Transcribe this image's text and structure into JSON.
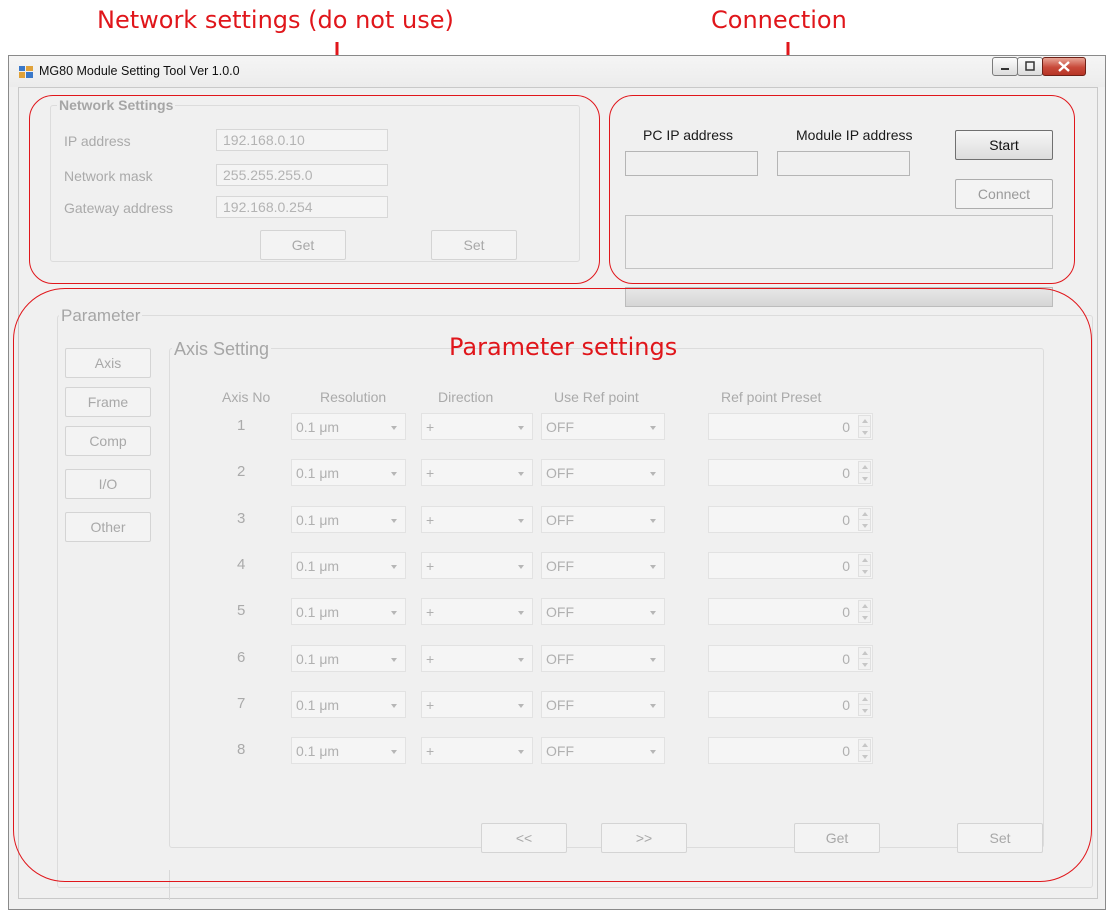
{
  "annotations": {
    "network_callout": "Network settings (do not use)",
    "connection_callout": "Connection",
    "parameter_callout": "Parameter settings",
    "color": "#e0161b"
  },
  "window": {
    "title": "MG80 Module Setting Tool Ver 1.0.0",
    "icon": "app-grid-icon"
  },
  "network": {
    "group_label": "Network Settings",
    "ip_label": "IP address",
    "ip_value": "192.168.0.10",
    "mask_label": "Network mask",
    "mask_value": "255.255.255.0",
    "gateway_label": "Gateway address",
    "gateway_value": "192.168.0.254",
    "get_label": "Get",
    "set_label": "Set"
  },
  "connection": {
    "pc_ip_label": "PC IP address",
    "pc_ip_value": "",
    "module_ip_label": "Module IP address",
    "module_ip_value": "",
    "start_label": "Start",
    "connect_label": "Connect",
    "status_text": ""
  },
  "parameter": {
    "group_label": "Parameter",
    "nav_buttons": [
      "Axis",
      "Frame",
      "Comp",
      "I/O",
      "Other"
    ],
    "axis_group_label": "Axis Setting",
    "columns": {
      "axis_no": "Axis No",
      "resolution": "Resolution",
      "direction": "Direction",
      "use_ref": "Use Ref point",
      "ref_preset": "Ref point Preset"
    },
    "rows": [
      {
        "axis": "1",
        "resolution": "0.1 μm",
        "direction": "+",
        "use_ref": "OFF",
        "preset": "0"
      },
      {
        "axis": "2",
        "resolution": "0.1 μm",
        "direction": "+",
        "use_ref": "OFF",
        "preset": "0"
      },
      {
        "axis": "3",
        "resolution": "0.1 μm",
        "direction": "+",
        "use_ref": "OFF",
        "preset": "0"
      },
      {
        "axis": "4",
        "resolution": "0.1 μm",
        "direction": "+",
        "use_ref": "OFF",
        "preset": "0"
      },
      {
        "axis": "5",
        "resolution": "0.1 μm",
        "direction": "+",
        "use_ref": "OFF",
        "preset": "0"
      },
      {
        "axis": "6",
        "resolution": "0.1 μm",
        "direction": "+",
        "use_ref": "OFF",
        "preset": "0"
      },
      {
        "axis": "7",
        "resolution": "0.1 μm",
        "direction": "+",
        "use_ref": "OFF",
        "preset": "0"
      },
      {
        "axis": "8",
        "resolution": "0.1 μm",
        "direction": "+",
        "use_ref": "OFF",
        "preset": "0"
      }
    ],
    "prev_label": "<<",
    "next_label": ">>",
    "get_label": "Get",
    "set_label": "Set"
  }
}
